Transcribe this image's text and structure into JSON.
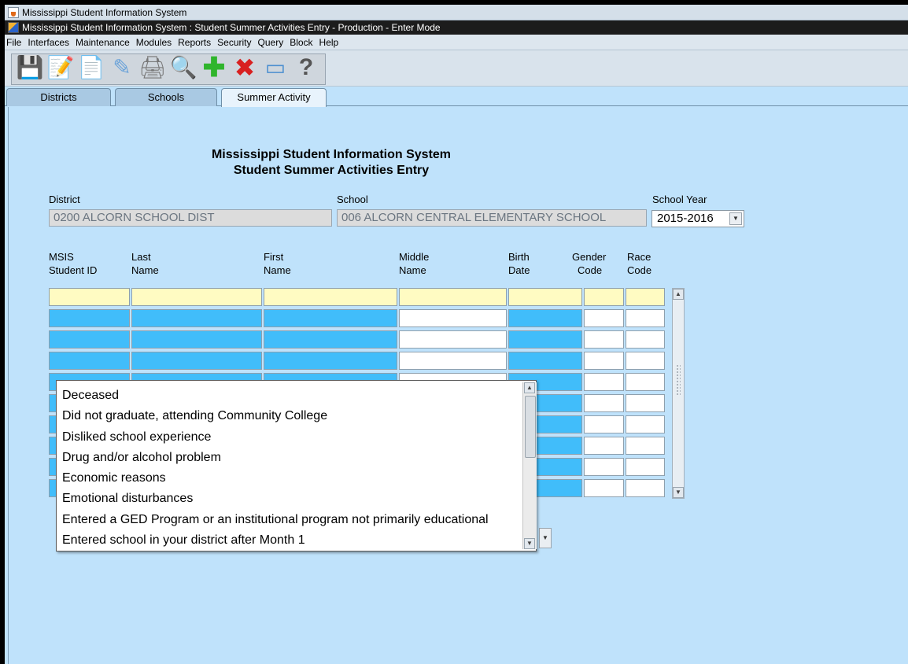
{
  "window": {
    "outer_title": "Mississippi Student Information System",
    "inner_title": "Mississippi Student Information System : Student Summer Activities Entry - Production - Enter Mode"
  },
  "menu": [
    {
      "label": "File"
    },
    {
      "label": "Interfaces"
    },
    {
      "label": "Maintenance"
    },
    {
      "label": "Modules"
    },
    {
      "label": "Reports"
    },
    {
      "label": "Security"
    },
    {
      "label": "Query"
    },
    {
      "label": "Block"
    },
    {
      "label": "Help"
    }
  ],
  "toolbar": [
    {
      "name": "save-icon",
      "glyph": "💾"
    },
    {
      "name": "edit-icon",
      "glyph": "📝"
    },
    {
      "name": "blank-document-icon",
      "glyph": "📄"
    },
    {
      "name": "eraser-icon",
      "glyph": "✎"
    },
    {
      "name": "printer-icon",
      "glyph": "🖨"
    },
    {
      "name": "search-icon",
      "glyph": "🔍"
    },
    {
      "name": "add-record-icon",
      "glyph": "✚"
    },
    {
      "name": "delete-record-icon",
      "glyph": "✖"
    },
    {
      "name": "close-window-icon",
      "glyph": "▭"
    },
    {
      "name": "help-icon",
      "glyph": "?"
    }
  ],
  "tabs": [
    {
      "label": "Districts"
    },
    {
      "label": "Schools"
    },
    {
      "label": "Summer Activity"
    }
  ],
  "header": {
    "line1": "Mississippi Student Information System",
    "line2": "Student Summer Activities Entry"
  },
  "fields": {
    "district_label": "District",
    "district_value": "0200  ALCORN SCHOOL DIST",
    "school_label": "School",
    "school_value": "006  ALCORN CENTRAL ELEMENTARY SCHOOL",
    "year_label": "School Year",
    "year_value": "2015-2016"
  },
  "columns": {
    "msis_1": "MSIS",
    "msis_2": "Student ID",
    "last_1": "Last",
    "last_2": "Name",
    "first_1": "First",
    "first_2": "Name",
    "middle_1": "Middle",
    "middle_2": "Name",
    "birth_1": "Birth",
    "birth_2": "Date",
    "gender_1": "Gender",
    "gender_2": "Code",
    "race_1": "Race",
    "race_2": "Code"
  },
  "dropdown_options": [
    "Deceased",
    "Did not graduate, attending Community College",
    "Disliked school experience",
    "Drug and/or alcohol problem",
    "Economic reasons",
    "Emotional disturbances",
    "Entered a GED Program or an institutional program not primarily educational",
    "Entered school in your district after Month 1"
  ],
  "colors": {
    "form_background": "#bfe2fb",
    "active_row": "#fffbc2",
    "locked_cell": "#41bdfa",
    "title_bar": "#1c1c1c"
  }
}
